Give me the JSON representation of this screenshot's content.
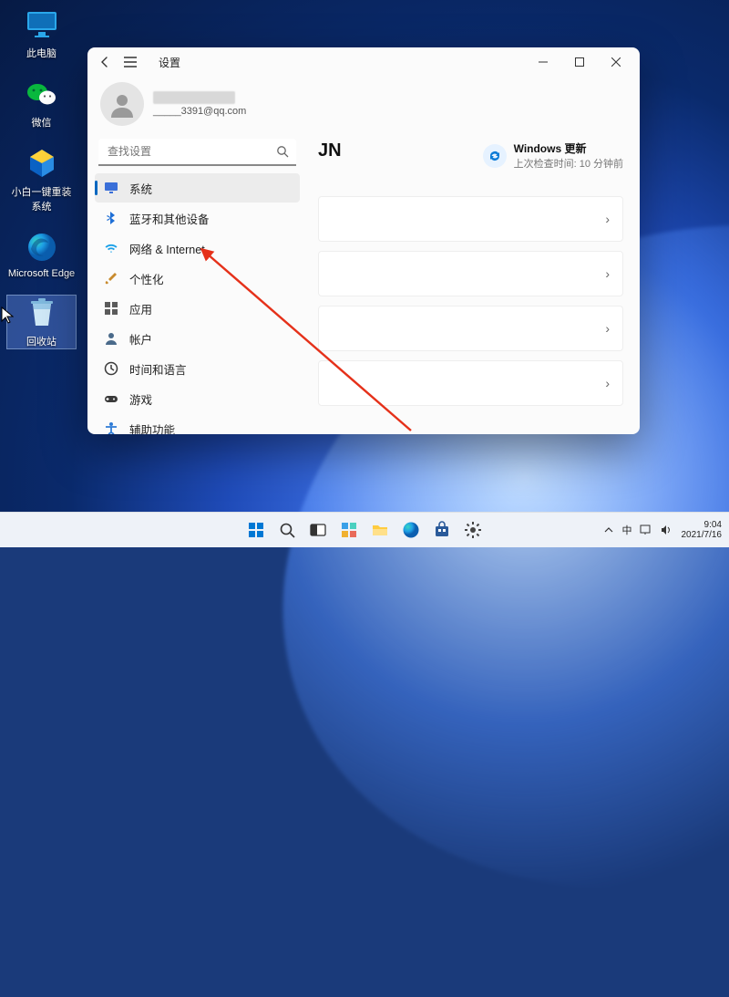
{
  "desktop": {
    "icons": [
      {
        "id": "this-pc",
        "label": "此电脑"
      },
      {
        "id": "wechat",
        "label": "微信"
      },
      {
        "id": "xiaobai",
        "label": "小白一键重装系统"
      },
      {
        "id": "edge",
        "label": "Microsoft Edge"
      },
      {
        "id": "recycle",
        "label": "回收站"
      }
    ]
  },
  "window": {
    "title": "设置",
    "account": {
      "email": "_____3391@qq.com"
    },
    "search": {
      "placeholder": "查找设置"
    },
    "nav": [
      {
        "id": "system",
        "label": "系统",
        "icon": "monitor",
        "active": true,
        "color": "#3a6fd8"
      },
      {
        "id": "bluetooth",
        "label": "蓝牙和其他设备",
        "icon": "bluetooth",
        "color": "#1e6fd6"
      },
      {
        "id": "network",
        "label": "网络 & Internet",
        "icon": "wifi",
        "color": "#1aa0e8"
      },
      {
        "id": "personal",
        "label": "个性化",
        "icon": "brush",
        "color": "#c88b2e"
      },
      {
        "id": "apps",
        "label": "应用",
        "icon": "grid",
        "color": "#5b5b5b"
      },
      {
        "id": "accounts",
        "label": "帐户",
        "icon": "person",
        "color": "#4a6a8a"
      },
      {
        "id": "time",
        "label": "时间和语言",
        "icon": "clock",
        "color": "#3a3a3a"
      },
      {
        "id": "gaming",
        "label": "游戏",
        "icon": "game",
        "color": "#3a3a3a"
      },
      {
        "id": "access",
        "label": "辅助功能",
        "icon": "access",
        "color": "#2e7bd6"
      }
    ],
    "content": {
      "heading_fragment": "JN",
      "update": {
        "title": "Windows 更新",
        "sub": "上次检查时间: 10 分钟前"
      },
      "row_count": 4
    }
  },
  "taskbar": {
    "items": [
      {
        "id": "start",
        "name": "start-button"
      },
      {
        "id": "search",
        "name": "taskbar-search"
      },
      {
        "id": "taskview",
        "name": "task-view"
      },
      {
        "id": "widgets",
        "name": "widgets"
      },
      {
        "id": "explorer",
        "name": "file-explorer"
      },
      {
        "id": "edge",
        "name": "taskbar-edge"
      },
      {
        "id": "store",
        "name": "microsoft-store"
      },
      {
        "id": "settings",
        "name": "taskbar-settings"
      }
    ],
    "tray": {
      "ime": "中",
      "time": "9:04",
      "date": "2021/7/16"
    }
  }
}
